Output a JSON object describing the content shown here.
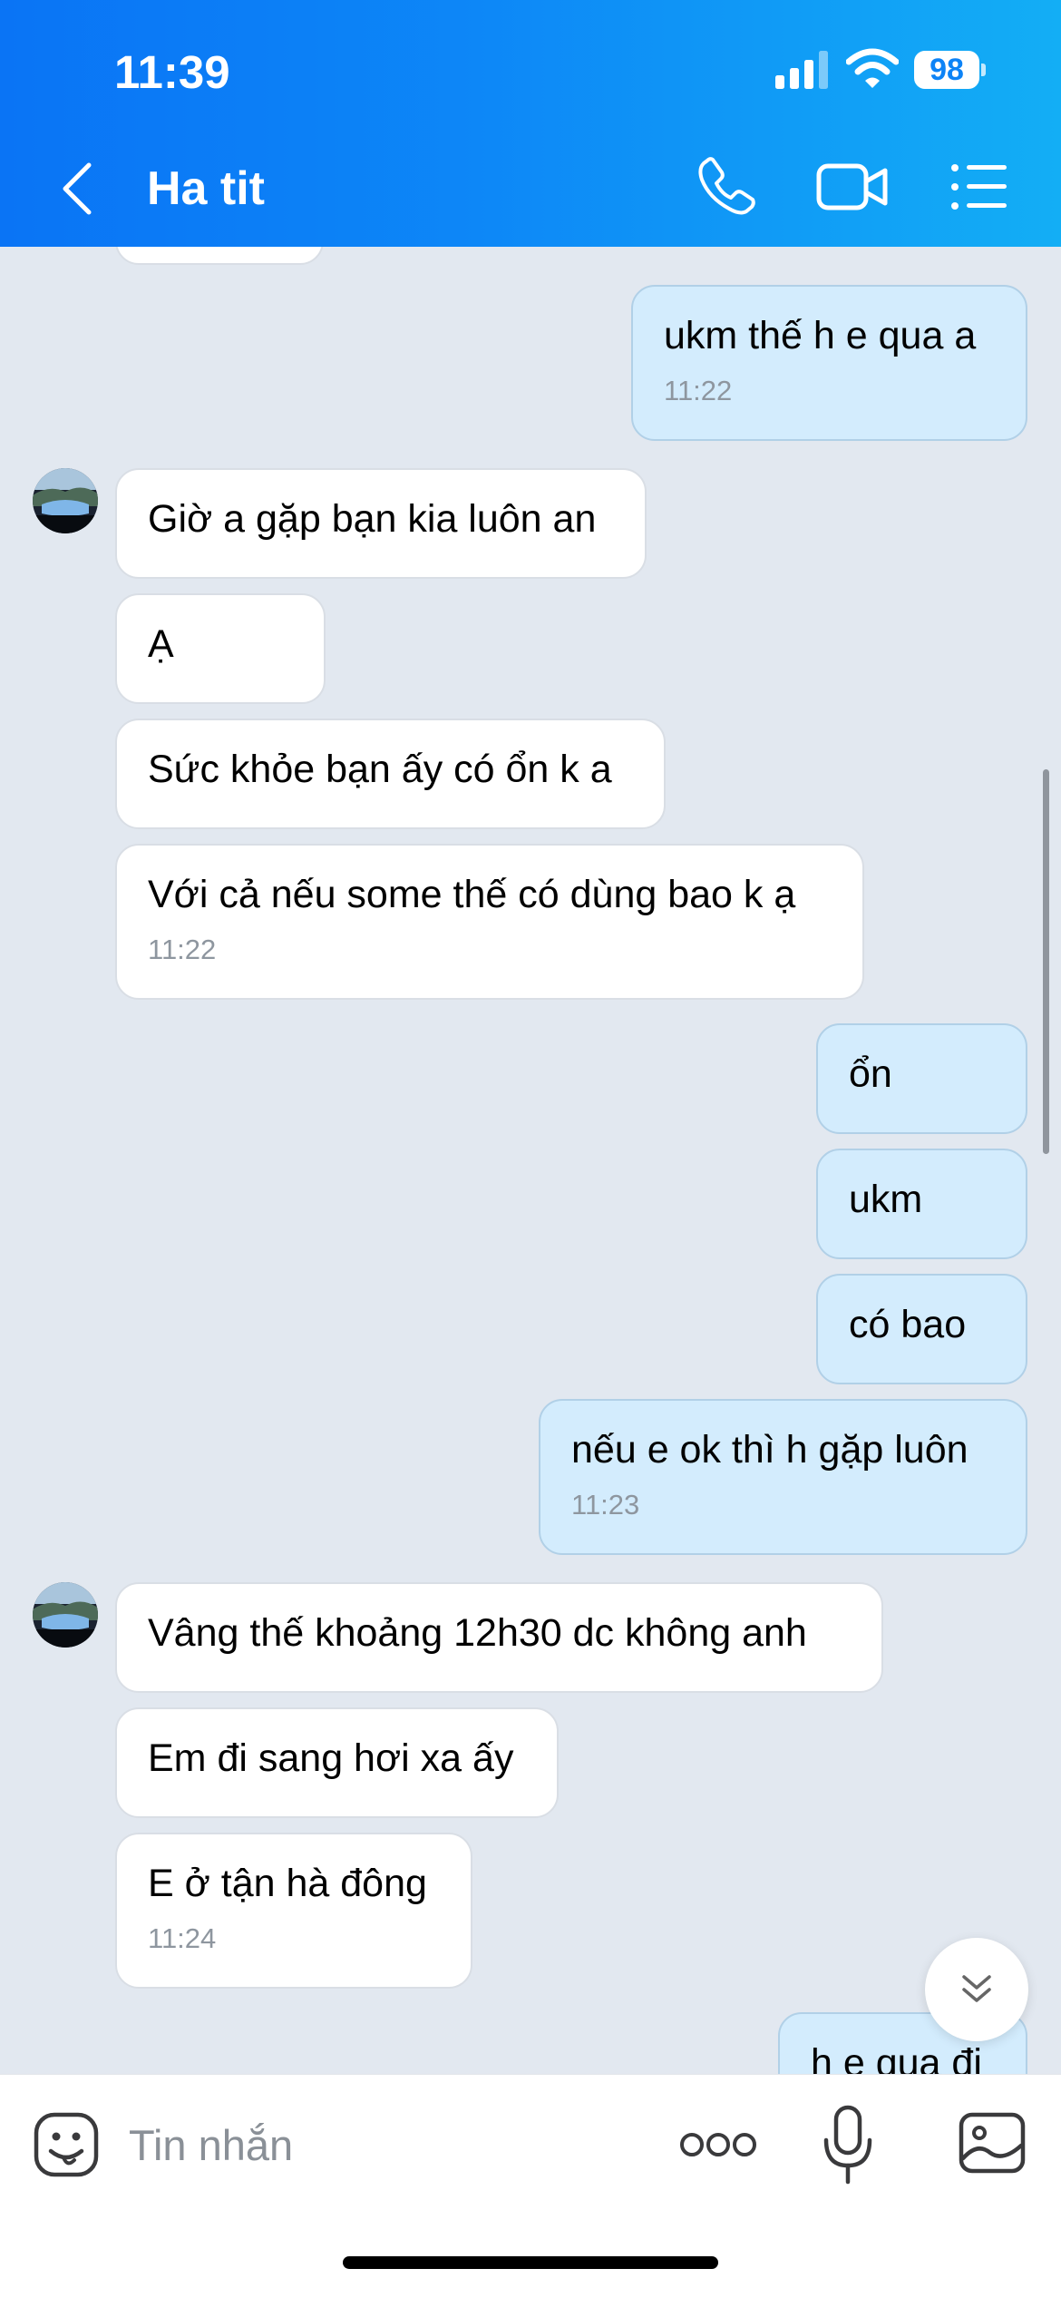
{
  "status_bar": {
    "time": "11:39",
    "battery": "98"
  },
  "header": {
    "contact_name": "Ha tit"
  },
  "messages": [
    {
      "text": "ukm thế h e qua a",
      "time": "11:22"
    },
    {
      "text": "Giờ a gặp bạn kia luôn an"
    },
    {
      "text": "Ạ"
    },
    {
      "text": "Sức khỏe bạn ấy có ổn k a"
    },
    {
      "text": "Với cả nếu some thế có dùng bao k ạ",
      "time": "11:22"
    },
    {
      "text": "ổn"
    },
    {
      "text": "ukm"
    },
    {
      "text": "có bao"
    },
    {
      "text": "nếu e ok thì h gặp luôn",
      "time": "11:23"
    },
    {
      "text": "Vâng thế khoảng 12h30 dc không anh"
    },
    {
      "text": "Em đi sang hơi xa ấy"
    },
    {
      "text": "E ở tận hà đông",
      "time": "11:24"
    },
    {
      "text": "h e qua đi"
    }
  ],
  "input": {
    "placeholder": "Tin nhắn"
  },
  "colors": {
    "header_start": "#0a74f5",
    "header_end": "#13aef5",
    "outgoing_bubble": "#d3ecfd",
    "incoming_bubble": "#ffffff",
    "chat_background": "#e2e8f0"
  },
  "icons": [
    "back-arrow-icon",
    "phone-icon",
    "video-camera-icon",
    "list-menu-icon",
    "sticker-icon",
    "more-icon",
    "microphone-icon",
    "image-icon",
    "double-chevron-down-icon"
  ]
}
